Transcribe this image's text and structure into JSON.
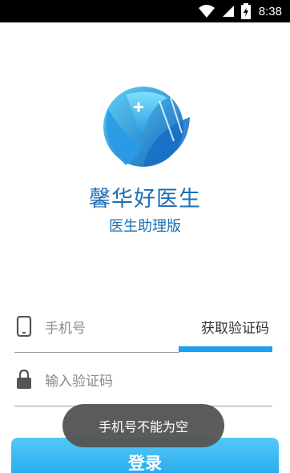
{
  "status_bar": {
    "time": "8:38"
  },
  "app": {
    "name": "馨华好医生",
    "subtitle": "医生助理版"
  },
  "form": {
    "phone_placeholder": "手机号",
    "get_code_label": "获取验证码",
    "code_placeholder": "输入验证码",
    "login_label": "登录"
  },
  "toast": {
    "message": "手机号不能为空"
  },
  "colors": {
    "brand_blue": "#1d6fb5",
    "accent": "#1e9ff2"
  },
  "icons": [
    "wifi-icon",
    "signal-icon",
    "battery-charging-icon",
    "phone-icon",
    "lock-icon"
  ]
}
